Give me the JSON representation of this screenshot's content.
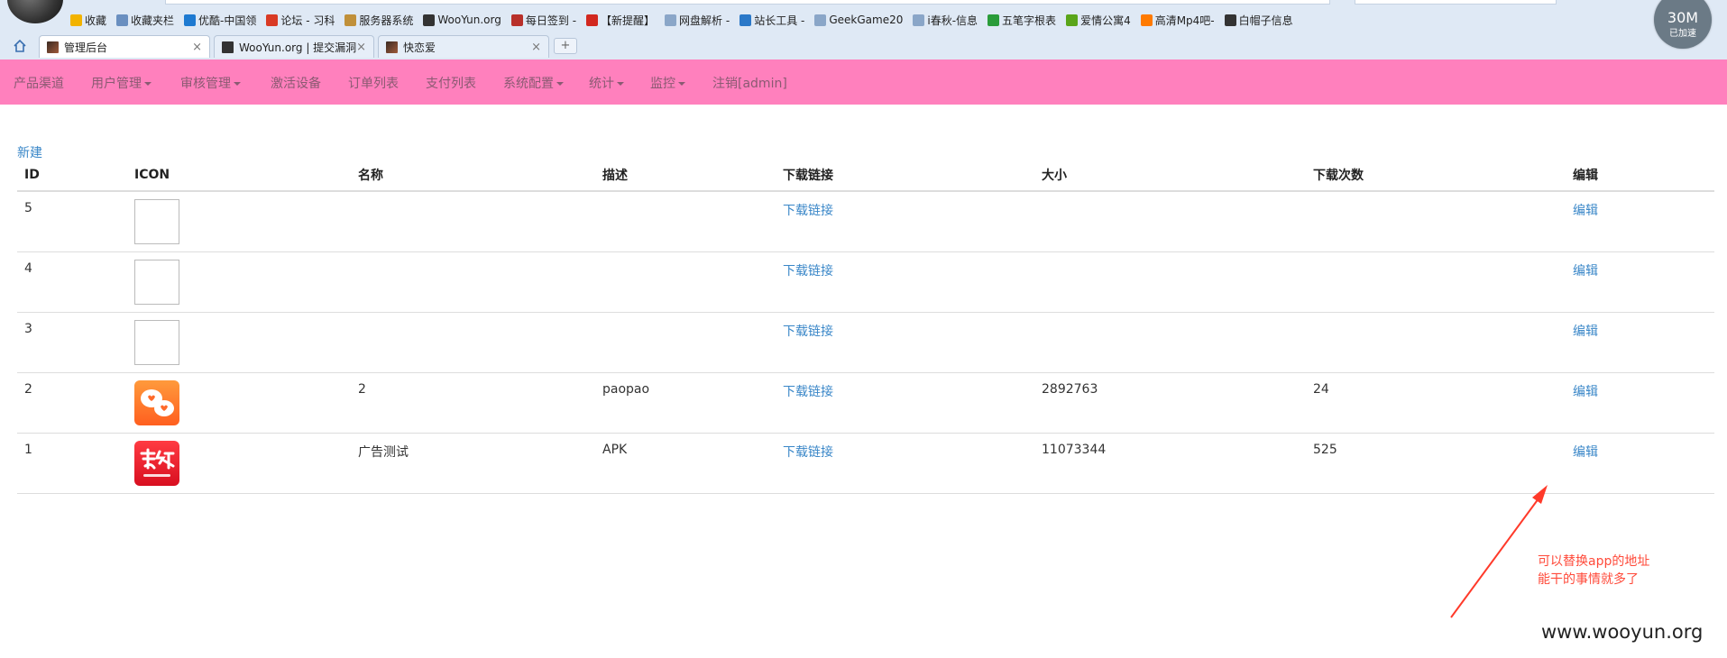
{
  "browser": {
    "bookmarks": [
      {
        "label": "收藏",
        "icon": "star-icon",
        "color": "#f2b300"
      },
      {
        "label": "收藏夹栏",
        "icon": "folder-icon",
        "color": "#6a8fc0"
      },
      {
        "label": "优酷-中国领",
        "icon": "youku-icon",
        "color": "#1e7ad1"
      },
      {
        "label": "论坛 - 习科",
        "icon": "forum-icon",
        "color": "#d93a24"
      },
      {
        "label": "服务器系统",
        "icon": "pen-icon",
        "color": "#c0903a"
      },
      {
        "label": "WooYun.org",
        "icon": "wooyun-icon",
        "color": "#333333"
      },
      {
        "label": "每日签到 -",
        "icon": "checkin-icon",
        "color": "#b8302a"
      },
      {
        "label": "【新提醒】",
        "icon": "remind-icon",
        "color": "#d2281f"
      },
      {
        "label": "网盘解析 -",
        "icon": "page-icon",
        "color": "#8aa6c8"
      },
      {
        "label": "站长工具 -",
        "icon": "tool-icon",
        "color": "#2a78c8"
      },
      {
        "label": "GeekGame20",
        "icon": "page-icon",
        "color": "#8aa6c8"
      },
      {
        "label": "i春秋-信息",
        "icon": "page-icon",
        "color": "#8aa6c8"
      },
      {
        "label": "五笔字根表",
        "icon": "leaf-icon",
        "color": "#2a9c3a"
      },
      {
        "label": "爱情公寓4",
        "icon": "iqiyi-icon",
        "color": "#5aa51a"
      },
      {
        "label": "高清Mp4吧-",
        "icon": "play-icon",
        "color": "#ff7a00"
      },
      {
        "label": "白帽子信息",
        "icon": "wooyun-icon",
        "color": "#333333"
      }
    ],
    "tabs": [
      {
        "title": "管理后台",
        "active": true
      },
      {
        "title": "WooYun.org | 提交漏洞",
        "active": false
      },
      {
        "title": "快恋爱",
        "active": false
      }
    ],
    "new_tab": "+",
    "close": "×",
    "speed": {
      "value": "30M",
      "label": "已加速"
    }
  },
  "nav": {
    "bg": "#ff80bd",
    "items": [
      {
        "label": "产品渠道",
        "dropdown": false
      },
      {
        "label": "用户管理",
        "dropdown": true
      },
      {
        "label": "审核管理",
        "dropdown": true
      },
      {
        "label": "激活设备",
        "dropdown": false
      },
      {
        "label": "订单列表",
        "dropdown": false
      },
      {
        "label": "支付列表",
        "dropdown": false
      },
      {
        "label": "系统配置",
        "dropdown": true
      },
      {
        "label": "统计",
        "dropdown": true
      },
      {
        "label": "监控",
        "dropdown": true
      },
      {
        "label": "注销[admin]",
        "dropdown": false
      }
    ]
  },
  "main": {
    "new_link": "新建",
    "columns": [
      "ID",
      "ICON",
      "名称",
      "描述",
      "下载链接",
      "大小",
      "下载次数",
      "编辑"
    ],
    "rows": [
      {
        "id": "5",
        "icon": "empty",
        "name": "",
        "desc": "",
        "download": "下载链接",
        "size": "",
        "count": "",
        "edit": "编辑"
      },
      {
        "id": "4",
        "icon": "empty",
        "name": "",
        "desc": "",
        "download": "下载链接",
        "size": "",
        "count": "",
        "edit": "编辑"
      },
      {
        "id": "3",
        "icon": "empty",
        "name": "",
        "desc": "",
        "download": "下载链接",
        "size": "",
        "count": "",
        "edit": "编辑"
      },
      {
        "id": "2",
        "icon": "paopao-app-icon",
        "name": "2",
        "desc": "paopao",
        "download": "下载链接",
        "size": "2892763",
        "count": "24",
        "edit": "编辑"
      },
      {
        "id": "1",
        "icon": "youyuan-app-icon",
        "name": "广告测试",
        "desc": "APK",
        "download": "下载链接",
        "size": "11073344",
        "count": "525",
        "edit": "编辑"
      }
    ],
    "link_color": "#3a87c8"
  },
  "annotation": {
    "lines": [
      "可以替换app的地址",
      "能干的事情就多了"
    ],
    "color": "#ff4a3a"
  },
  "watermark": "www.wooyun.org"
}
